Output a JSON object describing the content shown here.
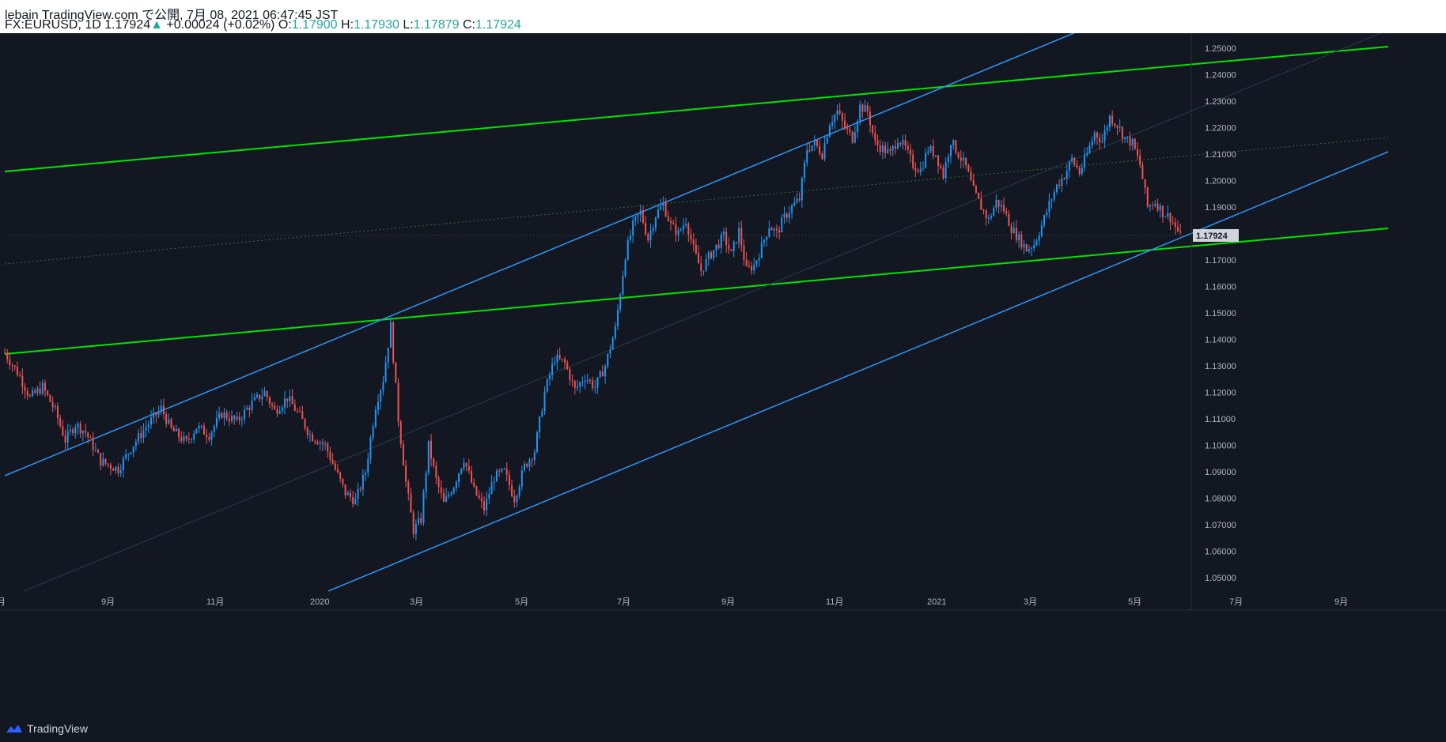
{
  "header": {
    "publish_line": "lebain TradingView.com で公開, 7月 08, 2021 06:47:45 JST",
    "symbol": "FX:EURUSD, 1D",
    "last": "1.17924",
    "change_arrow": "▲",
    "change": "+0.00024 (+0.02%)",
    "o_label": "O:",
    "o_value": "1.17900",
    "h_label": "H:",
    "h_value": "1.17930",
    "l_label": "L:",
    "l_value": "1.17879",
    "c_label": "C:",
    "c_value": "1.17924"
  },
  "footer": {
    "brand": "TradingView",
    "logo_icon": "tradingview-logo-icon"
  },
  "colors": {
    "background": "#131722",
    "up": "#2196f3",
    "down": "#ef5350",
    "green_line": "#00e600",
    "blue_line": "#2f8fe8",
    "axis_text": "#b2b5be"
  },
  "chart_data": {
    "type": "candlestick",
    "symbol": "FX:EURUSD",
    "interval": "1D",
    "ylim": [
      1.045,
      1.255
    ],
    "y_ticks": [
      "1.05000",
      "1.06000",
      "1.07000",
      "1.08000",
      "1.09000",
      "1.10000",
      "1.11000",
      "1.12000",
      "1.13000",
      "1.14000",
      "1.15000",
      "1.16000",
      "1.17000",
      "1.18000",
      "1.19000",
      "1.20000",
      "1.21000",
      "1.22000",
      "1.23000",
      "1.24000",
      "1.25000"
    ],
    "last_price_label": "1.17924",
    "x_ticks": [
      "月",
      "9月",
      "11月",
      "2020",
      "3月",
      "5月",
      "7月",
      "9月",
      "11月",
      "2021",
      "3月",
      "5月",
      "7月",
      "9月"
    ],
    "price_path": [
      [
        0,
        1.135
      ],
      [
        6,
        1.126
      ],
      [
        10,
        1.118
      ],
      [
        15,
        1.122
      ],
      [
        20,
        1.113
      ],
      [
        24,
        1.102
      ],
      [
        28,
        1.108
      ],
      [
        32,
        1.105
      ],
      [
        38,
        1.094
      ],
      [
        45,
        1.091
      ],
      [
        50,
        1.099
      ],
      [
        56,
        1.107
      ],
      [
        62,
        1.114
      ],
      [
        66,
        1.106
      ],
      [
        72,
        1.101
      ],
      [
        76,
        1.107
      ],
      [
        81,
        1.104
      ],
      [
        86,
        1.112
      ],
      [
        92,
        1.109
      ],
      [
        98,
        1.116
      ],
      [
        103,
        1.12
      ],
      [
        107,
        1.113
      ],
      [
        112,
        1.118
      ],
      [
        117,
        1.111
      ],
      [
        121,
        1.104
      ],
      [
        127,
        1.1
      ],
      [
        131,
        1.091
      ],
      [
        135,
        1.082
      ],
      [
        139,
        1.079
      ],
      [
        143,
        1.09
      ],
      [
        147,
        1.115
      ],
      [
        150,
        1.125
      ],
      [
        153,
        1.145
      ],
      [
        156,
        1.11
      ],
      [
        159,
        1.086
      ],
      [
        162,
        1.068
      ],
      [
        165,
        1.072
      ],
      [
        168,
        1.1
      ],
      [
        171,
        1.087
      ],
      [
        174,
        1.078
      ],
      [
        178,
        1.085
      ],
      [
        182,
        1.095
      ],
      [
        186,
        1.083
      ],
      [
        190,
        1.076
      ],
      [
        194,
        1.088
      ],
      [
        198,
        1.09
      ],
      [
        202,
        1.08
      ],
      [
        206,
        1.092
      ],
      [
        210,
        1.098
      ],
      [
        214,
        1.12
      ],
      [
        218,
        1.133
      ],
      [
        222,
        1.131
      ],
      [
        226,
        1.121
      ],
      [
        230,
        1.126
      ],
      [
        234,
        1.122
      ],
      [
        238,
        1.13
      ],
      [
        242,
        1.144
      ],
      [
        246,
        1.172
      ],
      [
        249,
        1.183
      ],
      [
        252,
        1.188
      ],
      [
        255,
        1.178
      ],
      [
        258,
        1.187
      ],
      [
        261,
        1.191
      ],
      [
        264,
        1.183
      ],
      [
        267,
        1.18
      ],
      [
        270,
        1.185
      ],
      [
        273,
        1.174
      ],
      [
        276,
        1.166
      ],
      [
        279,
        1.171
      ],
      [
        282,
        1.175
      ],
      [
        285,
        1.179
      ],
      [
        288,
        1.172
      ],
      [
        291,
        1.181
      ],
      [
        294,
        1.166
      ],
      [
        297,
        1.168
      ],
      [
        300,
        1.175
      ],
      [
        303,
        1.183
      ],
      [
        306,
        1.18
      ],
      [
        309,
        1.186
      ],
      [
        312,
        1.19
      ],
      [
        315,
        1.193
      ],
      [
        318,
        1.212
      ],
      [
        321,
        1.214
      ],
      [
        324,
        1.21
      ],
      [
        327,
        1.222
      ],
      [
        330,
        1.226
      ],
      [
        333,
        1.22
      ],
      [
        336,
        1.216
      ],
      [
        339,
        1.228
      ],
      [
        342,
        1.226
      ],
      [
        345,
        1.214
      ],
      [
        348,
        1.212
      ],
      [
        351,
        1.21
      ],
      [
        354,
        1.216
      ],
      [
        357,
        1.212
      ],
      [
        360,
        1.206
      ],
      [
        363,
        1.204
      ],
      [
        366,
        1.212
      ],
      [
        369,
        1.21
      ],
      [
        372,
        1.202
      ],
      [
        375,
        1.215
      ],
      [
        378,
        1.21
      ],
      [
        381,
        1.205
      ],
      [
        384,
        1.196
      ],
      [
        387,
        1.19
      ],
      [
        390,
        1.185
      ],
      [
        393,
        1.192
      ],
      [
        396,
        1.189
      ],
      [
        399,
        1.182
      ],
      [
        402,
        1.178
      ],
      [
        405,
        1.174
      ],
      [
        408,
        1.176
      ],
      [
        411,
        1.183
      ],
      [
        414,
        1.191
      ],
      [
        417,
        1.198
      ],
      [
        420,
        1.202
      ],
      [
        423,
        1.208
      ],
      [
        426,
        1.203
      ],
      [
        429,
        1.21
      ],
      [
        432,
        1.218
      ],
      [
        435,
        1.215
      ],
      [
        438,
        1.224
      ],
      [
        441,
        1.221
      ],
      [
        444,
        1.216
      ],
      [
        447,
        1.214
      ],
      [
        450,
        1.206
      ],
      [
        453,
        1.19
      ],
      [
        456,
        1.192
      ],
      [
        459,
        1.188
      ],
      [
        462,
        1.186
      ],
      [
        466,
        1.179
      ]
    ]
  }
}
